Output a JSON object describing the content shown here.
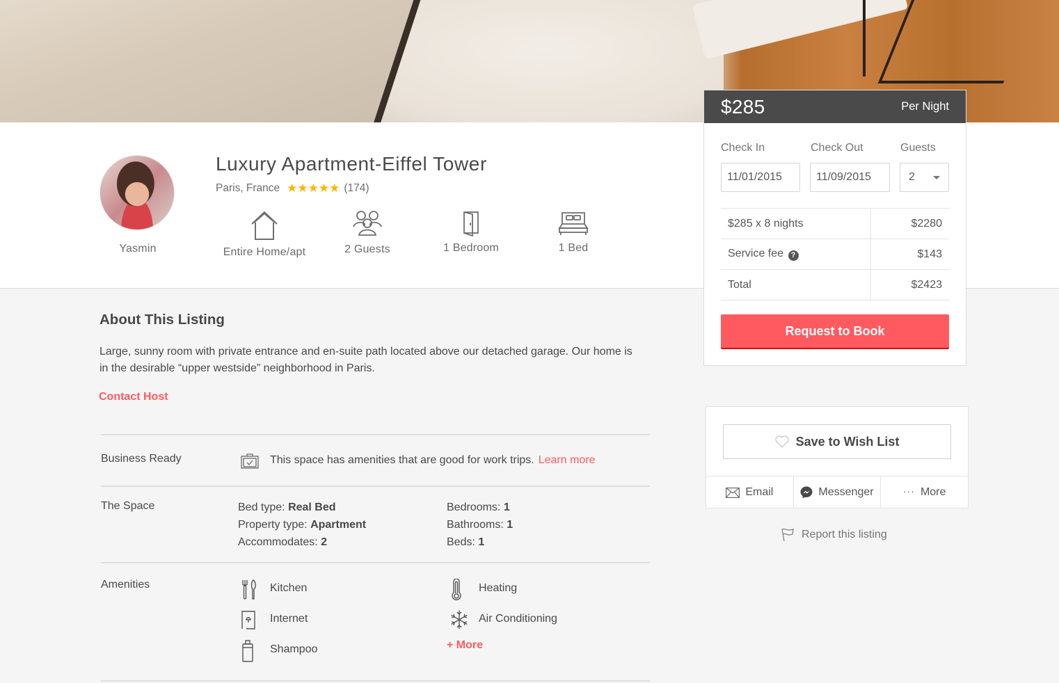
{
  "booking": {
    "price": "$285",
    "per_label": "Per Night",
    "checkin_label": "Check In",
    "checkout_label": "Check Out",
    "guests_label": "Guests",
    "checkin_value": "11/01/2015",
    "checkout_value": "11/09/2015",
    "guests_value": "2",
    "lines": [
      {
        "label": "$285 x 8 nights",
        "amount": "$2280"
      },
      {
        "label": "Service fee",
        "amount": "$143"
      },
      {
        "label": "Total",
        "amount": "$2423"
      }
    ],
    "request_label": "Request to Book"
  },
  "host": {
    "name": "Yasmin"
  },
  "listing": {
    "title": "Luxury Apartment-Eiffel Tower",
    "location": "Paris, France",
    "stars": "★★★★★",
    "rating_value": 5,
    "reviews": "(174)",
    "summary": [
      {
        "icon": "house-icon",
        "label": "Entire Home/apt"
      },
      {
        "icon": "guests-icon",
        "label": "2 Guests"
      },
      {
        "icon": "door-icon",
        "label": "1 Bedroom"
      },
      {
        "icon": "bed-icon",
        "label": "1 Bed"
      }
    ]
  },
  "about": {
    "title": "About This Listing",
    "description": "Large, sunny room with private entrance and en-suite path located above our detached garage. Our home is in the desirable “upper westside” neighborhood in Paris.",
    "contact_label": "Contact Host"
  },
  "business": {
    "label": "Business Ready",
    "text": "This space has amenities that are good for work trips.",
    "link": "Learn more"
  },
  "space": {
    "label": "The Space",
    "left": [
      {
        "key": "Bed type:",
        "value": "Real Bed"
      },
      {
        "key": "Property type:",
        "value": "Apartment"
      },
      {
        "key": "Accommodates:",
        "value": "2"
      }
    ],
    "right": [
      {
        "key": "Bedrooms:",
        "value": "1"
      },
      {
        "key": "Bathrooms:",
        "value": "1"
      },
      {
        "key": "Beds:",
        "value": "1"
      }
    ]
  },
  "amenities": {
    "label": "Amenities",
    "items": [
      {
        "icon": "kitchen-icon",
        "label": "Kitchen"
      },
      {
        "icon": "internet-icon",
        "label": "Internet"
      },
      {
        "icon": "shampoo-icon",
        "label": "Shampoo"
      },
      {
        "icon": "heating-icon",
        "label": "Heating"
      },
      {
        "icon": "air-conditioning-icon",
        "label": "Air Conditioning"
      }
    ],
    "more_label": "+ More"
  },
  "share": {
    "wishlist_label": "Save to Wish List",
    "email_label": "Email",
    "messenger_label": "Messenger",
    "more_label": "More",
    "report_label": "Report this listing"
  },
  "colors": {
    "accent": "#ff5a5f",
    "star": "#ffb400",
    "text": "#484848"
  }
}
